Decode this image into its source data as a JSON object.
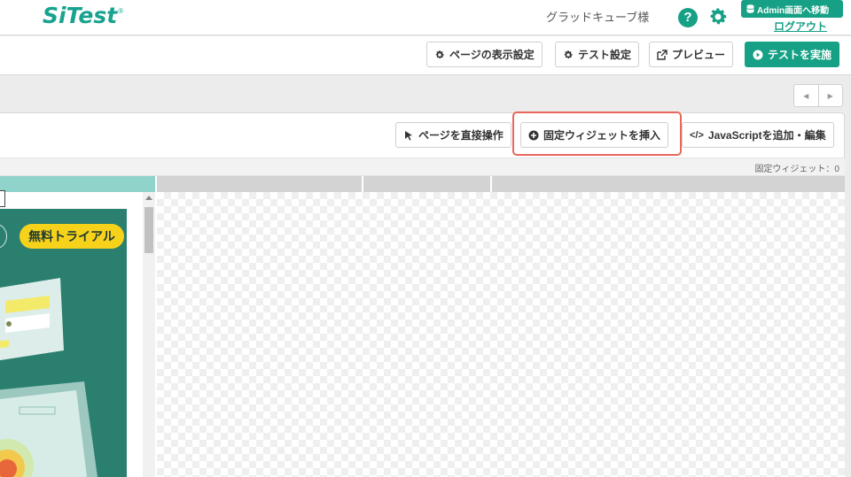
{
  "header": {
    "logo_text": "SiTest",
    "user_name": "グラッドキューブ様",
    "admin_label": "Admin画面へ移動",
    "logout_label": "ログアウト"
  },
  "toolbar": {
    "page_display_settings": "ページの表示設定",
    "test_settings": "テスト設定",
    "preview": "プレビュー",
    "run_test": "テストを実施"
  },
  "panel": {
    "direct_operate": "ページを直接操作",
    "insert_widget": "固定ウィジェットを挿入",
    "add_js": "JavaScriptを追加・編集",
    "widget_count": "固定ウィジェット：0"
  },
  "preview": {
    "trial_badge": "無料トライアル"
  },
  "colors": {
    "brand": "#16a085",
    "highlight": "#e8675a",
    "banner": "#2b7f6f",
    "badge": "#f6d21b"
  }
}
